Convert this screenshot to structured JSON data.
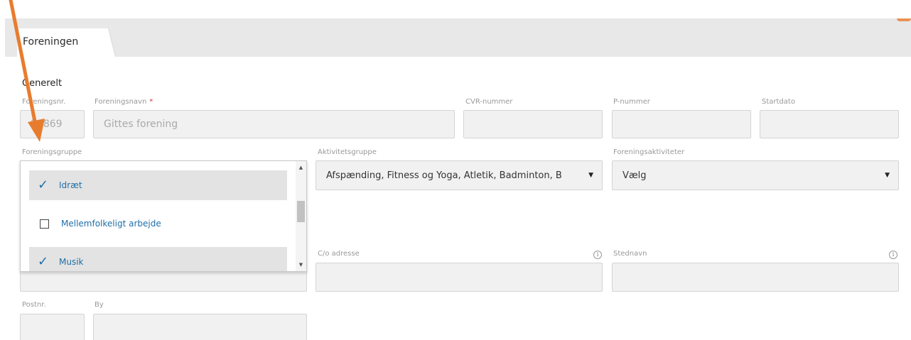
{
  "tab": {
    "label": "Foreningen"
  },
  "section": {
    "title": "Generelt"
  },
  "fields": {
    "foreningsnr": {
      "label": "Foreningsnr.",
      "value": "21869"
    },
    "foreningsnavn": {
      "label": "Foreningsnavn",
      "required_mark": "*",
      "value": "Gittes forening"
    },
    "cvr": {
      "label": "CVR-nummer",
      "value": ""
    },
    "pnummer": {
      "label": "P-nummer",
      "value": ""
    },
    "startdato": {
      "label": "Startdato",
      "value": ""
    },
    "foreningsgruppe": {
      "label": "Foreningsgruppe"
    },
    "aktivitetsgruppe": {
      "label": "Aktivitetsgruppe",
      "value": "Afspænding, Fitness og Yoga, Atletik, Badminton, B"
    },
    "foreningsaktiviteter": {
      "label": "Foreningsaktiviteter",
      "value": "Vælg"
    },
    "co_adresse": {
      "label": "C/o adresse",
      "value": ""
    },
    "stednavn": {
      "label": "Stednavn",
      "value": ""
    },
    "postnr": {
      "label": "Postnr.",
      "value": ""
    },
    "by": {
      "label": "By",
      "value": ""
    }
  },
  "dropdown": {
    "options": [
      {
        "label": "Idræt",
        "checked": true
      },
      {
        "label": "Mellemfolkeligt arbejde",
        "checked": false
      },
      {
        "label": "Musik",
        "checked": true
      }
    ]
  },
  "icons": {
    "check": "check-icon",
    "checkbox": "checkbox-icon",
    "caret": "caret-down-icon",
    "info": "info-icon"
  },
  "colors": {
    "accent": "#1f6fa8",
    "required": "#d9343a",
    "annotation_arrow": "#e87c2e"
  }
}
